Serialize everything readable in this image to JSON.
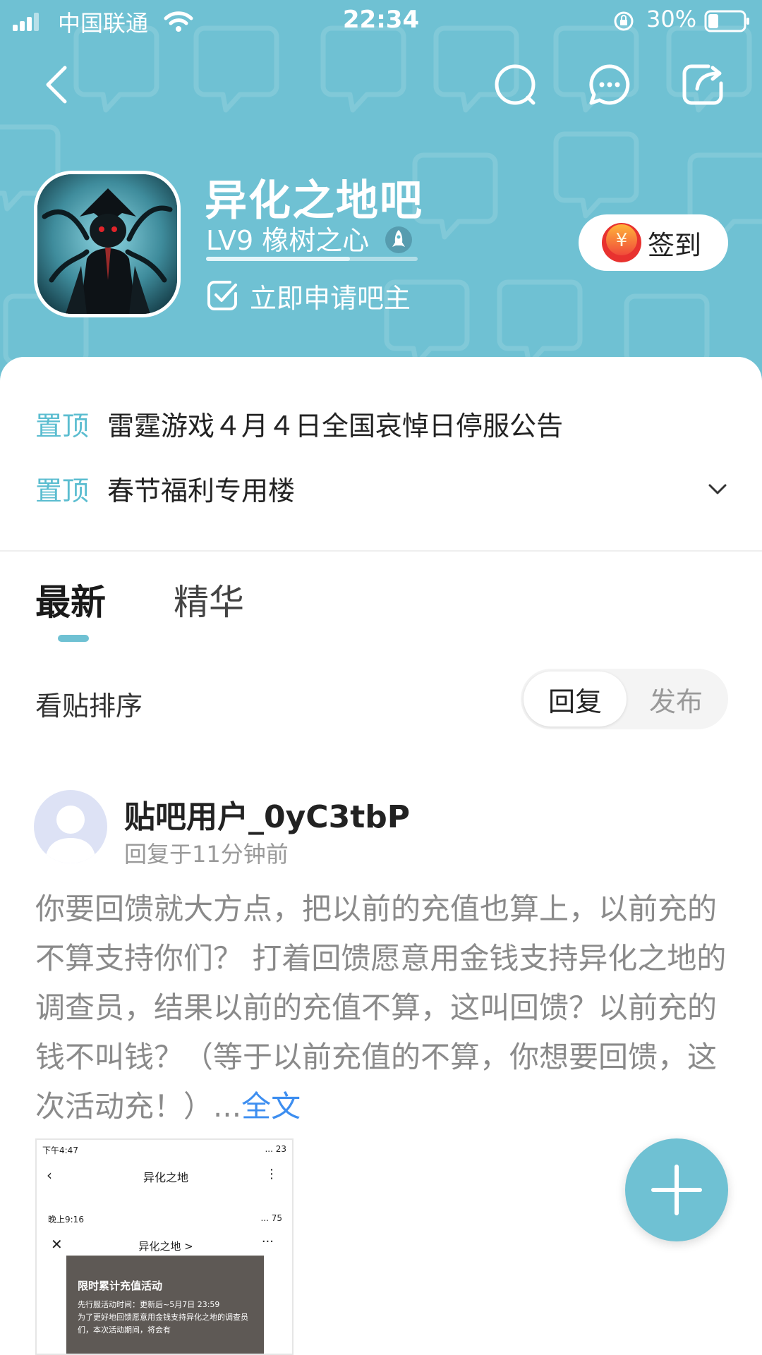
{
  "status_bar": {
    "carrier": "中国联通",
    "time": "22:34",
    "battery": "30%"
  },
  "nav": {
    "icons": [
      "back-icon",
      "search-icon",
      "chat-icon",
      "share-icon"
    ]
  },
  "forum": {
    "name": "异化之地吧",
    "level": "LV9 橡树之心",
    "level_progress": 0.68,
    "apply_label": "立即申请吧主",
    "signin_label": "签到",
    "coin_symbol": "¥"
  },
  "pinned": [
    {
      "label": "置顶",
      "title": "雷霆游戏４月４日全国哀悼日停服公告"
    },
    {
      "label": "置顶",
      "title": "春节福利专用楼"
    }
  ],
  "tabs": {
    "latest": "最新",
    "featured": "精华"
  },
  "sort": {
    "label": "看贴排序",
    "option_reply": "回复",
    "option_publish": "发布"
  },
  "post": {
    "username": "贴吧用户_0yC3tbP",
    "time": "回复于11分钟前",
    "body": "你要回馈就大方点，把以前的充值也算上，以前充的不算支持你们？ 打着回馈愿意用金钱支持异化之地的调查员，结果以前的充值不算，这叫回馈？以前充的钱不叫钱？（等于以前充值的不算，你想要回馈，这次活动充！）...",
    "more": "全文",
    "thumbnail": {
      "status_time": "下午4:47",
      "status_right": "... 23",
      "app_title": "异化之地",
      "status_time2": "晚上9:16",
      "status_right2": "... 75",
      "page_title": "异化之地 >",
      "panel_title": "限时累计充值活动",
      "panel_line1": "先行服活动时间：更新后~5月7日 23:59",
      "panel_line2": "为了更好地回馈愿意用金钱支持异化之地的调查员们，本次活动期间，将会有"
    }
  },
  "colors": {
    "header_bg": "#6fc1d3",
    "accent": "#5bbdd0",
    "link": "#3d8ef0"
  }
}
